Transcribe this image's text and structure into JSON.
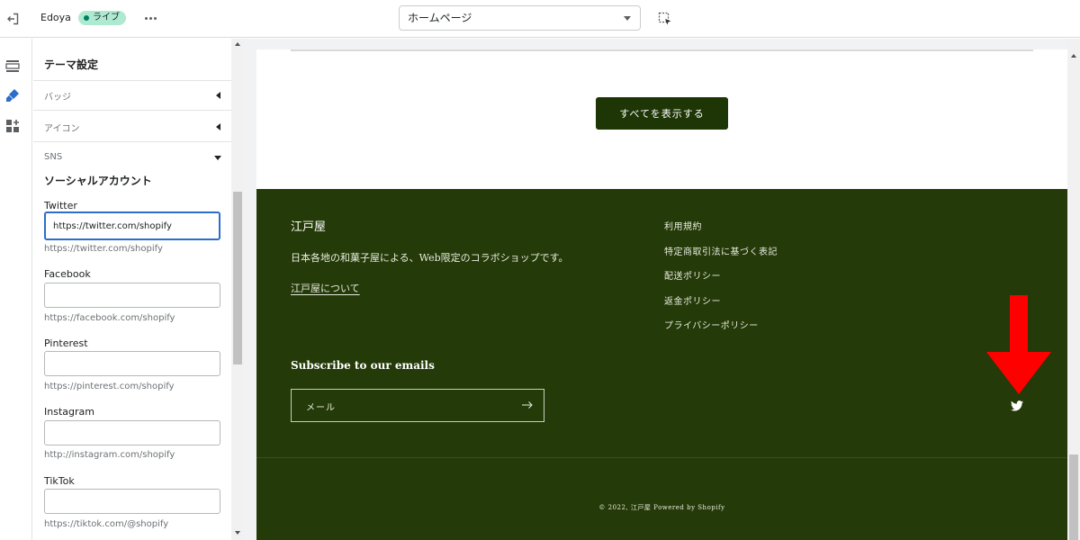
{
  "topbar": {
    "store_name": "Edoya",
    "live_badge": "ライブ",
    "page_select": "ホームページ"
  },
  "panel": {
    "title": "テーマ設定",
    "sections": {
      "badge": "バッジ",
      "icon": "アイコン",
      "sns": "SNS"
    },
    "social_heading": "ソーシャルアカウント",
    "fields": [
      {
        "label": "Twitter",
        "value": "https://twitter.com/shopify",
        "help": "https://twitter.com/shopify"
      },
      {
        "label": "Facebook",
        "value": "",
        "help": "https://facebook.com/shopify"
      },
      {
        "label": "Pinterest",
        "value": "",
        "help": "https://pinterest.com/shopify"
      },
      {
        "label": "Instagram",
        "value": "",
        "help": "http://instagram.com/shopify"
      },
      {
        "label": "TikTok",
        "value": "",
        "help": "https://tiktok.com/@shopify"
      }
    ]
  },
  "preview": {
    "show_all_button": "すべてを表示する",
    "footer": {
      "brand": "江戸屋",
      "tagline": "日本各地の和菓子屋による、Web限定のコラボショップです。",
      "about_link": "江戸屋について",
      "links": [
        "利用規約",
        "特定商取引法に基づく表記",
        "配送ポリシー",
        "返金ポリシー",
        "プライバシーポリシー"
      ],
      "subscribe_title": "Subscribe to our emails",
      "email_placeholder": "メール",
      "copyright": "© 2022, 江戸屋 Powered by Shopify"
    }
  },
  "colors": {
    "footer_bg": "#243a08",
    "button_bg": "#1e3506",
    "focus_border": "#2c6ecb",
    "annotation_arrow": "#ff0000"
  },
  "icons": {
    "exit": "exit-icon",
    "more": "more-icon",
    "inspect": "inspector-icon",
    "sections": "sections-icon",
    "theme_settings": "brush-icon",
    "app_blocks": "apps-icon",
    "submit": "arrow-right-icon",
    "twitter": "twitter-icon"
  }
}
